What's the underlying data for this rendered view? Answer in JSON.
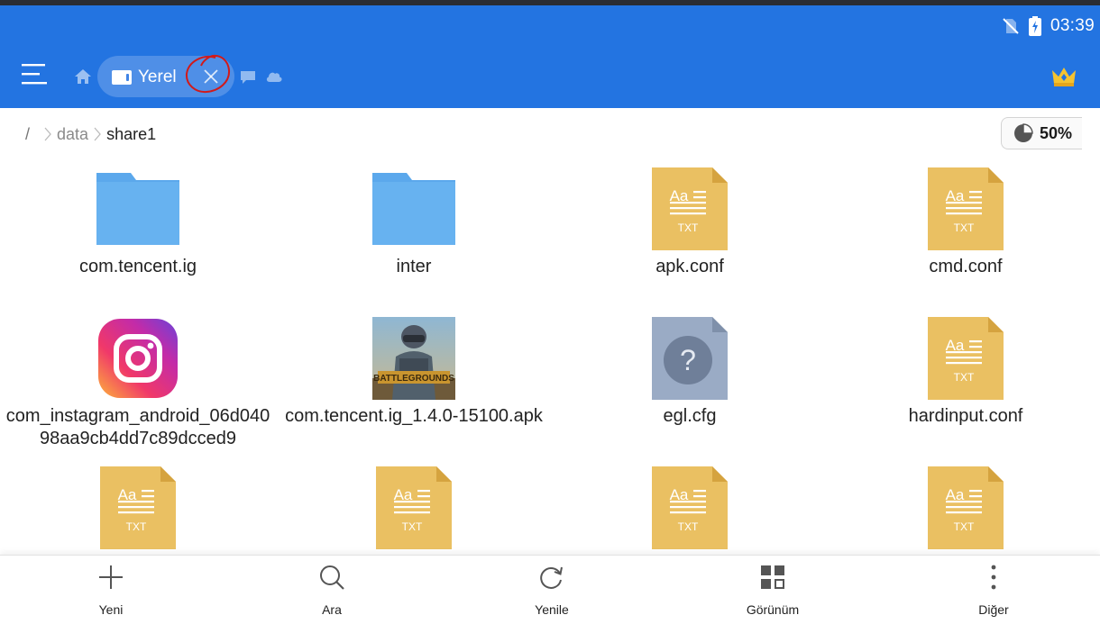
{
  "status": {
    "time": "03:39"
  },
  "header": {
    "tab_label": "Yerel",
    "accent": "#2374e1",
    "icons": [
      "menu-icon",
      "home-icon",
      "phone-icon",
      "close-icon",
      "message-icon",
      "cloud-icon",
      "crown-icon"
    ]
  },
  "breadcrumb": {
    "root": "/",
    "items": [
      "data",
      "share1"
    ]
  },
  "storage": {
    "percent_text": "50%",
    "percent": 50
  },
  "files": [
    {
      "name": "com.tencent.ig",
      "type": "folder"
    },
    {
      "name": "inter",
      "type": "folder"
    },
    {
      "name": "apk.conf",
      "type": "txt"
    },
    {
      "name": "cmd.conf",
      "type": "txt"
    },
    {
      "name": "com_instagram_android_06d04098aa9cb4dd7c89dcced9",
      "type": "instagram"
    },
    {
      "name": "com.tencent.ig_1.4.0-15100.apk",
      "type": "apk"
    },
    {
      "name": "egl.cfg",
      "type": "unknown"
    },
    {
      "name": "hardinput.conf",
      "type": "txt"
    },
    {
      "name": "",
      "type": "txt"
    },
    {
      "name": "",
      "type": "txt"
    },
    {
      "name": "",
      "type": "txt"
    },
    {
      "name": "",
      "type": "txt"
    }
  ],
  "file_icon_text": {
    "aa": "Aa",
    "txt": "TXT",
    "unknown": "?"
  },
  "apk_thumb_text": "BATTLEGROUNDS",
  "bottom_bar": [
    {
      "label": "Yeni",
      "icon": "plus-icon"
    },
    {
      "label": "Ara",
      "icon": "search-icon"
    },
    {
      "label": "Yenile",
      "icon": "refresh-icon"
    },
    {
      "label": "Görünüm",
      "icon": "grid-view-icon"
    },
    {
      "label": "Diğer",
      "icon": "more-icon"
    }
  ]
}
